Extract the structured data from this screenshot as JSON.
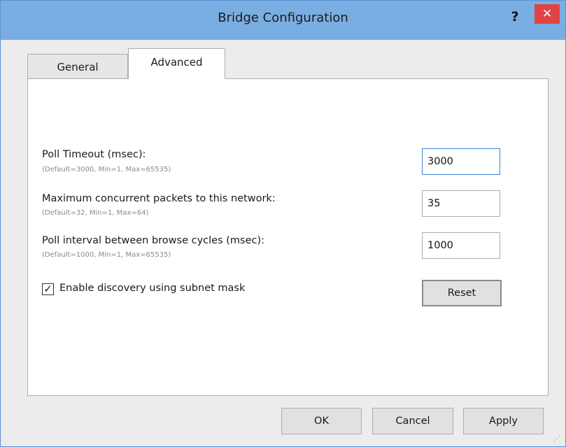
{
  "window": {
    "title": "Bridge Configuration",
    "help_label": "?",
    "close_label": "✕"
  },
  "tabs": [
    {
      "label": "General",
      "selected": false
    },
    {
      "label": "Advanced",
      "selected": true
    }
  ],
  "settings": [
    {
      "label": "Poll Timeout (msec):",
      "hint": "(Default=3000, Min=1, Max=65535)",
      "value": "3000"
    },
    {
      "label": "Maximum concurrent packets to this network:",
      "hint": "(Default=32, Min=1, Max=64)",
      "value": "35"
    },
    {
      "label": "Poll interval between browse cycles (msec):",
      "hint": "(Default=1000, Min=1, Max=65535)",
      "value": "1000"
    }
  ],
  "discovery": {
    "label": "Enable discovery using subnet mask",
    "checked": true,
    "check_glyph": "✓"
  },
  "buttons": {
    "reset": "Reset",
    "ok": "OK",
    "cancel": "Cancel",
    "apply": "Apply"
  },
  "colors": {
    "titlebar": "#79aee2",
    "close": "#e04343",
    "focus_border": "#3d80d8"
  }
}
